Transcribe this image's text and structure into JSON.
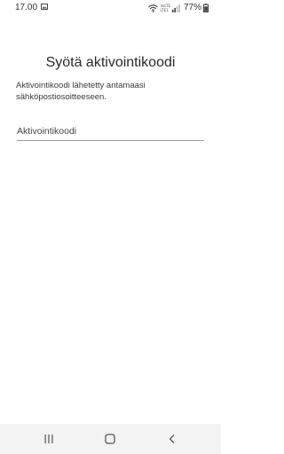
{
  "status_bar": {
    "time": "17.00",
    "network_label_top": "VoLTE",
    "network_label_bottom": "LTE1",
    "battery_percent": "77%",
    "icons": [
      "gallery-icon",
      "wifi-icon",
      "signal-icon",
      "battery-icon"
    ]
  },
  "screen": {
    "title": "Syötä aktivointikoodi",
    "description": "Aktivointikoodi lähetetty antamaasi sähköpostiosoitteeseen.",
    "activation_code_input": {
      "value": "",
      "placeholder": "Aktivointikoodi"
    }
  },
  "nav_bar": {
    "icons": [
      "recent-apps-icon",
      "home-icon",
      "back-icon"
    ],
    "background": "#f3f3f3"
  }
}
